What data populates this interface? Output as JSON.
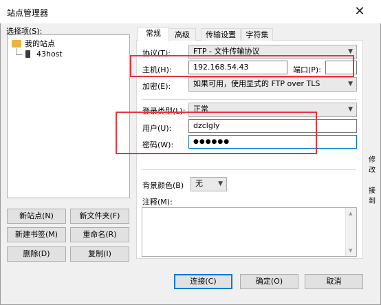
{
  "window": {
    "title": "站点管理器",
    "close_glyph": "✕"
  },
  "left": {
    "select_label": "选择项(S):",
    "tree": {
      "root": "我的站点",
      "child": "43host"
    },
    "buttons": {
      "new_site": "新站点(N)",
      "new_folder": "新文件夹(F)",
      "new_bookmark": "新建书签(M)",
      "rename": "重命名(R)",
      "delete": "删除(D)",
      "copy": "复制(I)"
    }
  },
  "tabs": [
    "常规",
    "高级",
    "传输设置",
    "字符集"
  ],
  "general": {
    "protocol_label": "协议(T):",
    "protocol_value": "FTP - 文件传输协议",
    "host_label": "主机(H):",
    "host_value": "192.168.54.43",
    "port_label": "端口(P):",
    "port_value": "",
    "encryption_label": "加密(E):",
    "encryption_value": "如果可用，使用显式的 FTP over TLS",
    "logon_label": "登录类型(L):",
    "logon_value": "正常",
    "user_label": "用户(U):",
    "user_value": "dzclgly",
    "password_label": "密码(W):",
    "password_value": "●●●●●●",
    "bgcolor_label": "背景颜色(B)",
    "bgcolor_value": "无",
    "comment_label": "注释(M):"
  },
  "footer": {
    "connect": "连接(C)",
    "ok": "确定(O)",
    "cancel": "取消"
  },
  "background_fragments": {
    "right1": "修改",
    "right2": "接到"
  },
  "colors": {
    "highlight": "#e8343b",
    "focus": "#0078d7"
  }
}
